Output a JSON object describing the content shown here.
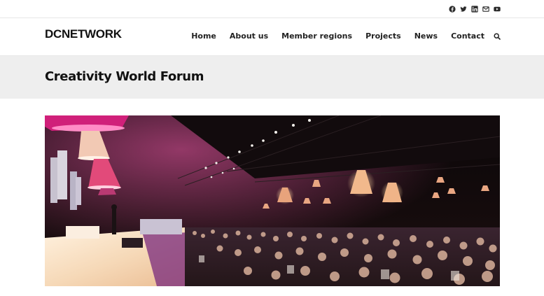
{
  "brand": {
    "logo_text": "DCNETWORK"
  },
  "social": [
    {
      "name": "facebook"
    },
    {
      "name": "twitter"
    },
    {
      "name": "linkedin"
    },
    {
      "name": "email"
    },
    {
      "name": "youtube"
    }
  ],
  "nav": {
    "items": [
      "Home",
      "About us",
      "Member regions",
      "Projects",
      "News",
      "Contact"
    ],
    "search_icon": "search-icon"
  },
  "page": {
    "title": "Creativity World Forum"
  },
  "colors": {
    "title_band": "#eeeeee",
    "text": "#1a1a1a",
    "stage_magenta": "#d0207a"
  }
}
